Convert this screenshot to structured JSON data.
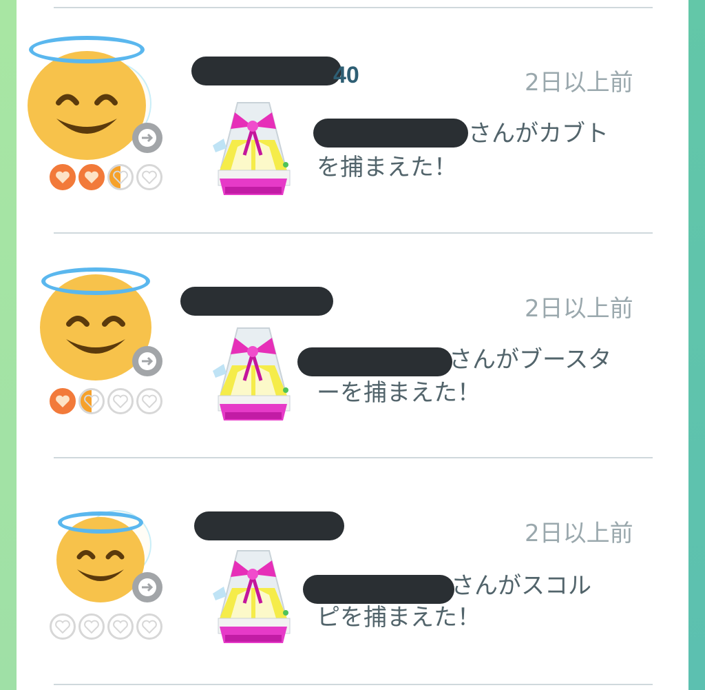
{
  "feed": {
    "items": [
      {
        "name_suffix": "40",
        "time": "2日以上前",
        "message_line1": "さんがカブト",
        "message_line2": "を捕まえた！",
        "hearts": [
          "full",
          "full",
          "half",
          "empty"
        ]
      },
      {
        "name_suffix": "",
        "time": "2日以上前",
        "message_line1": "さんがブースタ",
        "message_line2": "ーを捕まえた！",
        "hearts": [
          "full",
          "half",
          "empty",
          "empty"
        ]
      },
      {
        "name_suffix": "",
        "time": "2日以上前",
        "message_line1": "さんがスコル",
        "message_line2": "ピを捕まえた！",
        "hearts": [
          "empty",
          "empty",
          "empty",
          "empty"
        ]
      }
    ]
  },
  "colors": {
    "heart_full": "#f27a3a",
    "heart_half": "#f6a12a",
    "heart_empty": "#d7d7d7",
    "halo": "#5ab7ee",
    "face": "#f7c24b"
  },
  "icons": {
    "avatar": "halo-smiley-icon",
    "trainer_arrow": "arrow-right-icon",
    "heart": "heart-icon",
    "gift": "gift-icon"
  }
}
